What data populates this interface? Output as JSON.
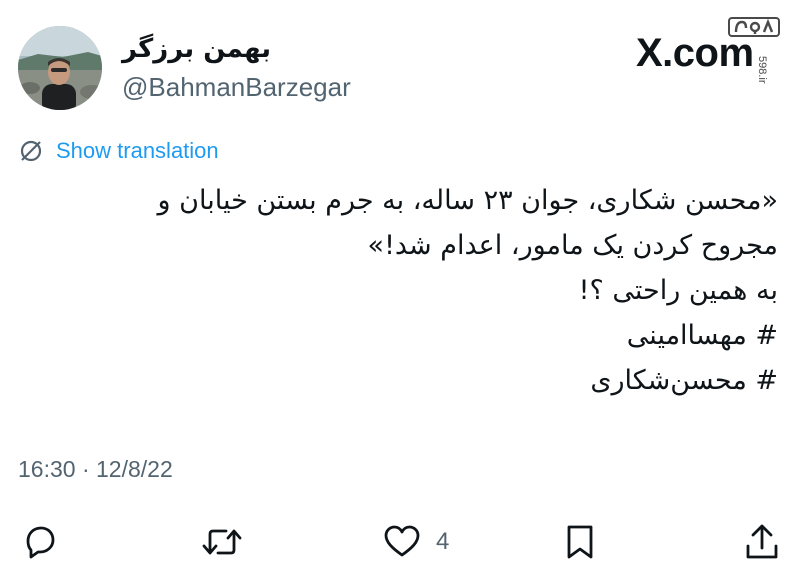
{
  "author": {
    "display_name": "بهمن برزگر",
    "handle": "@BahmanBarzegar",
    "avatar_icon": "profile-photo"
  },
  "brand": {
    "text": "X.com"
  },
  "watermark": {
    "logo_text": "۵۹۸",
    "site": "598.ir"
  },
  "translate": {
    "icon": "globe-slash-icon",
    "label": "Show translation"
  },
  "tweet": {
    "lines": [
      "«محسن شکاری، جوان ۲۳ ساله، به جرم بستن خیابان و",
      "مجروح کردن یک مامور، اعدام شد!»",
      "به همین راحتی ؟!",
      "# مهساامینی",
      "# محسن‌شکاری"
    ],
    "timestamp": "16:30 · 12/8/22"
  },
  "actions": {
    "reply_icon": "reply-icon",
    "retweet_icon": "retweet-icon",
    "like_icon": "heart-icon",
    "like_count": "4",
    "bookmark_icon": "bookmark-icon",
    "share_icon": "share-icon"
  },
  "colors": {
    "link": "#1d9bf0",
    "secondary_text": "#536471",
    "primary_text": "#0f1419"
  }
}
